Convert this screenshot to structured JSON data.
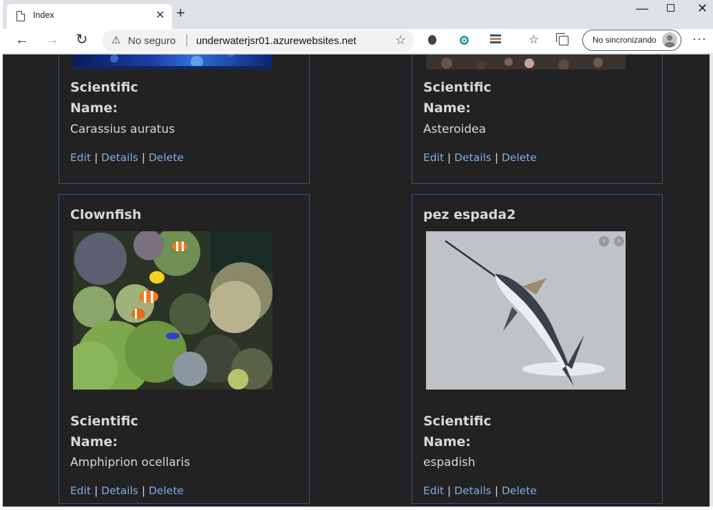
{
  "browser": {
    "tab_title": "Index",
    "security_label": "No seguro",
    "url": "underwaterjsr01.azurewebsites.net",
    "profile_label": "No sincronizando"
  },
  "colors": {
    "page_bg": "#222222",
    "card_border": "#2c5a8a",
    "link": "#7fb0e6",
    "text": "#d8d8d8"
  },
  "cards": [
    {
      "title": "",
      "sci_label": "Scientific Name:",
      "sci_value": "Carassius auratus",
      "image": "goldfish-aquarium-photo",
      "actions": {
        "edit": "Edit",
        "details": "Details",
        "delete": "Delete"
      }
    },
    {
      "title": "",
      "sci_label": "Scientific Name:",
      "sci_value": "Asteroidea",
      "image": "starfish-reef-photo",
      "actions": {
        "edit": "Edit",
        "details": "Details",
        "delete": "Delete"
      }
    },
    {
      "title": "Clownfish",
      "sci_label": "Scientific Name:",
      "sci_value": "Amphiprion ocellaris",
      "image": "clownfish-reef-photo",
      "actions": {
        "edit": "Edit",
        "details": "Details",
        "delete": "Delete"
      }
    },
    {
      "title": "pez espada2",
      "sci_label": "Scientific Name:",
      "sci_value": "espadish",
      "image": "swordfish-jumping-photo",
      "actions": {
        "edit": "Edit",
        "details": "Details",
        "delete": "Delete"
      }
    }
  ]
}
